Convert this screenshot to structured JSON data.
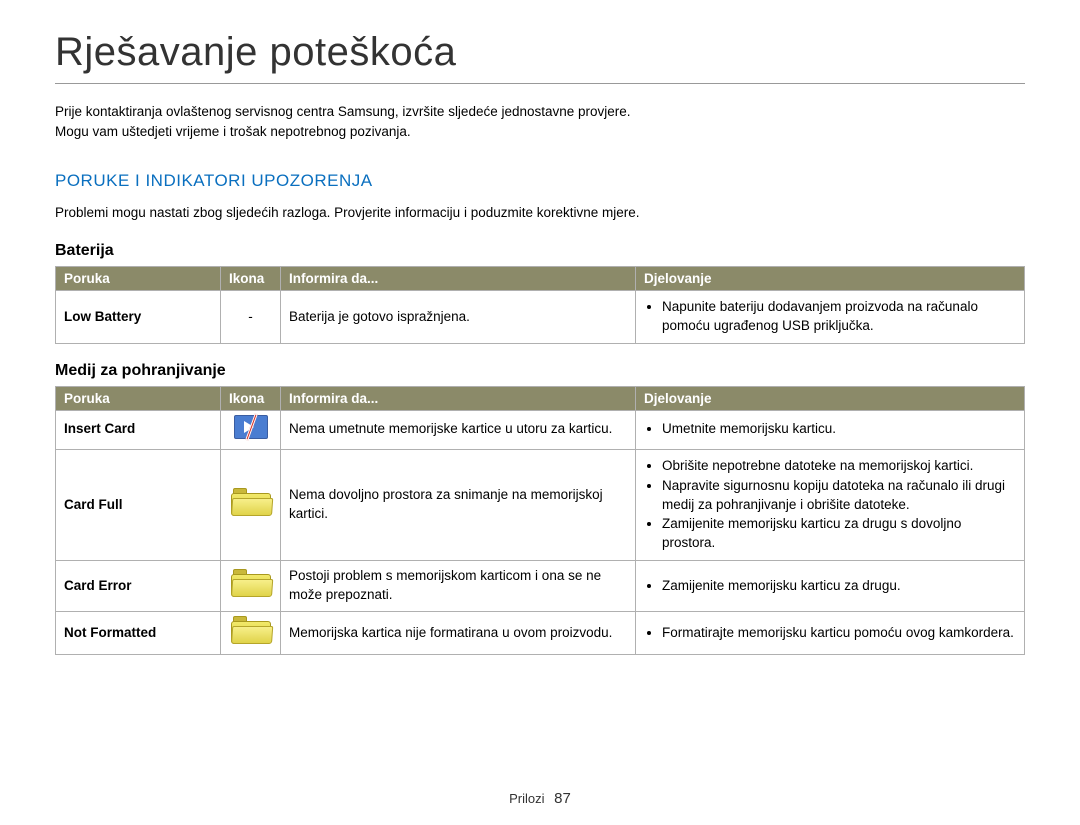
{
  "page_title": "Rješavanje poteškoća",
  "intro": {
    "line1": "Prije kontaktiranja ovlaštenog servisnog centra Samsung, izvršite sljedeće jednostavne provjere.",
    "line2": "Mogu vam uštedjeti vrijeme i trošak nepotrebnog pozivanja."
  },
  "section": {
    "heading": "PORUKE I INDIKATORI UPOZORENJA",
    "text": "Problemi mogu nastati zbog sljedećih razloga. Provjerite informaciju i poduzmite korektivne mjere."
  },
  "headers": {
    "poruka": "Poruka",
    "ikona": "Ikona",
    "informira": "Informira da...",
    "djelovanje": "Djelovanje"
  },
  "battery": {
    "title": "Baterija",
    "rows": [
      {
        "msg": "Low Battery",
        "icon": "-",
        "inform": "Baterija je gotovo ispražnjena.",
        "actions": [
          "Napunite bateriju dodavanjem proizvoda na računalo pomoću ugrađenog USB priključka."
        ]
      }
    ]
  },
  "storage": {
    "title": "Medij za pohranjivanje",
    "rows": [
      {
        "msg": "Insert Card",
        "icon": "card-slash",
        "inform": "Nema umetnute memorijske kartice u utoru za karticu.",
        "actions": [
          "Umetnite memorijsku karticu."
        ]
      },
      {
        "msg": "Card Full",
        "icon": "folder",
        "inform": "Nema dovoljno prostora za snimanje na memorijskoj kartici.",
        "actions": [
          "Obrišite nepotrebne datoteke na memorijskoj kartici.",
          "Napravite sigurnosnu kopiju datoteka na računalo ili drugi medij za pohranjivanje i obrišite datoteke.",
          "Zamijenite memorijsku karticu za drugu s dovoljno prostora."
        ]
      },
      {
        "msg": "Card Error",
        "icon": "folder",
        "inform": "Postoji problem s memorijskom karticom i ona se ne može prepoznati.",
        "actions": [
          "Zamijenite memorijsku karticu za drugu."
        ]
      },
      {
        "msg": "Not Formatted",
        "icon": "folder",
        "inform": "Memorijska kartica nije formatirana u ovom proizvodu.",
        "actions": [
          "Formatirajte memorijsku karticu pomoću ovog kamkordera."
        ]
      }
    ]
  },
  "footer": {
    "label": "Prilozi",
    "page": "87"
  }
}
